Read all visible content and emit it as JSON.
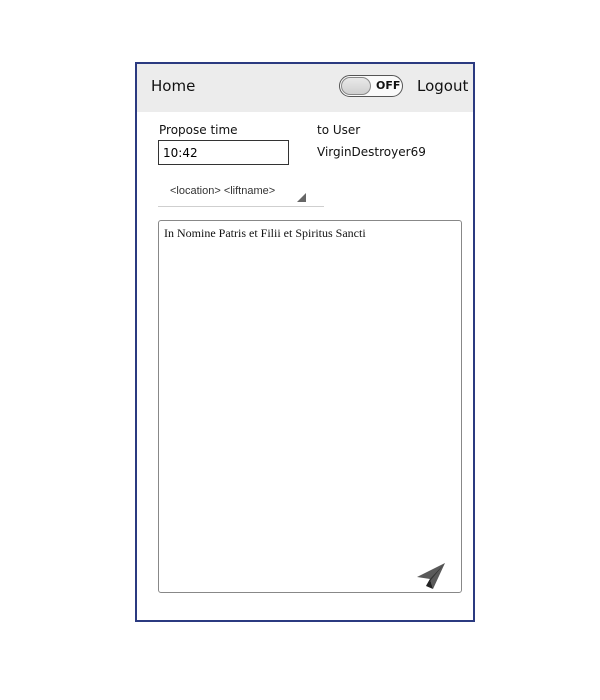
{
  "header": {
    "home_label": "Home",
    "toggle_state": "OFF",
    "logout_label": "Logout"
  },
  "form": {
    "propose_time_label": "Propose time",
    "time_value": "10:42",
    "to_user_label": "to User",
    "to_user_value": "VirginDestroyer69",
    "location_select_value": "<location> <liftname>",
    "message_text": "In Nomine Patris et Filii et Spiritus Sancti"
  },
  "icons": {
    "send": "paper-plane-icon",
    "dropdown": "triangle-down-icon"
  },
  "colors": {
    "frame_border": "#2b3a80",
    "header_bg": "#ececec"
  }
}
